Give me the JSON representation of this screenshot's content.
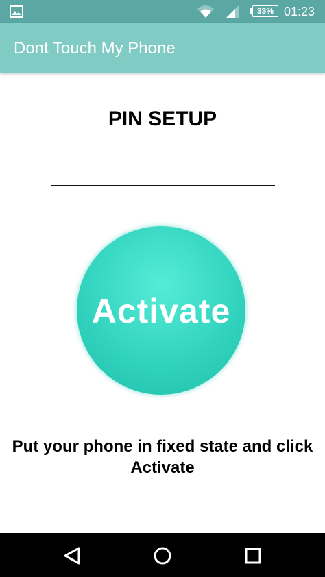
{
  "status_bar": {
    "notification_icon": "image-icon",
    "wifi_icon": "wifi-icon",
    "signal_icon": "signal-icon",
    "battery_percent": "33%",
    "time": "01:23"
  },
  "app_bar": {
    "title": "Dont Touch My Phone"
  },
  "main": {
    "heading": "PIN SETUP",
    "pin_value": "",
    "activate_label": "Activate",
    "instruction": "Put your phone in fixed state and click Activate"
  },
  "nav_bar": {
    "back_icon": "back-triangle-icon",
    "home_icon": "home-icon",
    "recents_icon": "recents-square-icon"
  },
  "colors": {
    "status_bar": "#5aa7a3",
    "app_bar": "#80cbc4",
    "activate_button": "#33d4bf",
    "nav_bar": "#000000"
  }
}
